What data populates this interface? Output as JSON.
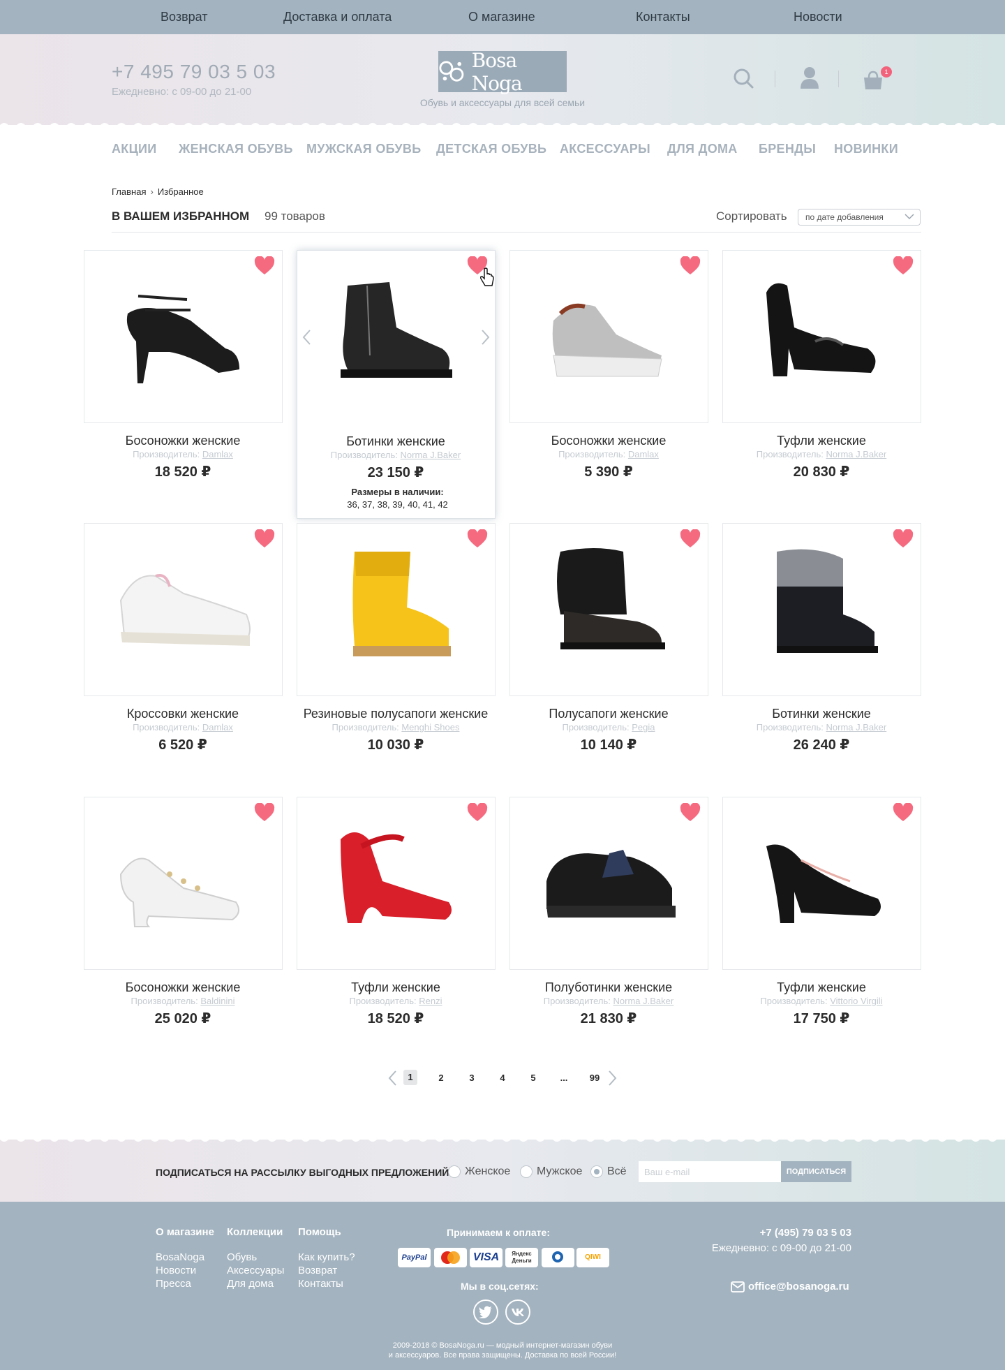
{
  "topnav": [
    "Возврат",
    "Доставка и оплата",
    "О магазине",
    "Контакты",
    "Новости"
  ],
  "header": {
    "phone": "+7 495 79 03 5 03",
    "hours": "Ежедневно: с 09-00 до 21-00",
    "logo": "Bosa Noga",
    "tagline": "Обувь и аксессуары для всей семьи",
    "cart_count": "1"
  },
  "catnav": [
    "АКЦИИ",
    "ЖЕНСКАЯ ОБУВЬ",
    "МУЖСКАЯ ОБУВЬ",
    "ДЕТСКАЯ ОБУВЬ",
    "АКСЕССУАРЫ",
    "ДЛЯ ДОМА",
    "БРЕНДЫ",
    "НОВИНКИ"
  ],
  "breadcrumbs": [
    "Главная",
    "Избранное"
  ],
  "favorites": {
    "title": "В ВАШЕМ ИЗБРАННОМ",
    "count": "99 товаров",
    "sort_label": "Сортировать",
    "sort_value": "по дате добавления"
  },
  "maker_label": "Производитель:",
  "products": [
    {
      "name": "Босоножки женские",
      "maker": "Damlax",
      "price": "18 520 ₽",
      "shoe": "sandal-heel-black"
    },
    {
      "name": "Ботинки женские",
      "maker": "Norma J.Baker",
      "price": "23 150 ₽",
      "shoe": "ankle-boot-black"
    },
    {
      "name": "Босоножки женские",
      "maker": "Damlax",
      "price": "5 390 ₽",
      "shoe": "wedge-sandal-white"
    },
    {
      "name": "Туфли женские",
      "maker": "Norma J.Baker",
      "price": "20 830 ₽",
      "shoe": "loafer-heel-black"
    },
    {
      "name": "Кроссовки женские",
      "maker": "Damlax",
      "price": "6 520 ₽",
      "shoe": "sneaker-white"
    },
    {
      "name": "Резиновые полусапоги женские",
      "maker": "Menghi Shoes",
      "price": "10 030 ₽",
      "shoe": "rain-boot-yellow"
    },
    {
      "name": "Полусапоги женские",
      "maker": "Pegia",
      "price": "10 140 ₽",
      "shoe": "fur-boot-black"
    },
    {
      "name": "Ботинки женские",
      "maker": "Norma J.Baker",
      "price": "26 240 ₽",
      "shoe": "fur-ankle-boot-black"
    },
    {
      "name": "Босоножки женские",
      "maker": "Baldinini",
      "price": "25 020 ₽",
      "shoe": "sandal-block-white"
    },
    {
      "name": "Туфли женские",
      "maker": "Renzi",
      "price": "18 520 ₽",
      "shoe": "mary-jane-red"
    },
    {
      "name": "Полуботинки женские",
      "maker": "Norma J.Baker",
      "price": "21 830 ₽",
      "shoe": "oxford-black"
    },
    {
      "name": "Туфли женские",
      "maker": "Vittorio Virgili",
      "price": "17 750 ₽",
      "shoe": "pump-black"
    }
  ],
  "sizes": {
    "label": "Размеры в наличии:",
    "values": "36, 37, 38, 39, 40, 41, 42"
  },
  "pagination": [
    "1",
    "2",
    "3",
    "4",
    "5",
    "...",
    "99"
  ],
  "subscribe": {
    "label": "ПОДПИСАТЬСЯ НА РАССЫЛКУ ВЫГОДНЫХ ПРЕДЛОЖЕНИЙ",
    "options": [
      "Женское",
      "Мужское",
      "Всё"
    ],
    "placeholder": "Ваш e-mail",
    "button": "ПОДПИСАТЬСЯ"
  },
  "footer": {
    "columns": [
      {
        "title": "О магазине",
        "links": [
          "BosaNoga",
          "Новости",
          "Пресса"
        ]
      },
      {
        "title": "Коллекции",
        "links": [
          "Обувь",
          "Аксессуары",
          "Для дома"
        ]
      },
      {
        "title": "Помощь",
        "links": [
          "Как купить?",
          "Возврат",
          "Контакты"
        ]
      }
    ],
    "payment_title": "Принимаем к оплате:",
    "payments": [
      "PayPal",
      "MasterCard",
      "VISA",
      "Яндекс Деньги",
      "WebMoney",
      "QIWI"
    ],
    "social_title": "Мы в соц.сетях:",
    "social": [
      "twitter",
      "vk"
    ],
    "phone": "+7 (495) 79 03 5 03",
    "hours": "Ежедневно: с 09-00 до 21-00",
    "email": "office@bosanoga.ru",
    "copyright_1": "2009-2018 © BosaNoga.ru — модный интернет-магазин обуви",
    "copyright_2": "и аксессуаров. Все права защищены. Доставка по всей России!"
  },
  "colors": {
    "accent": "#a3b3bf",
    "heart": "#f56a7f",
    "badge": "#f2637b"
  }
}
